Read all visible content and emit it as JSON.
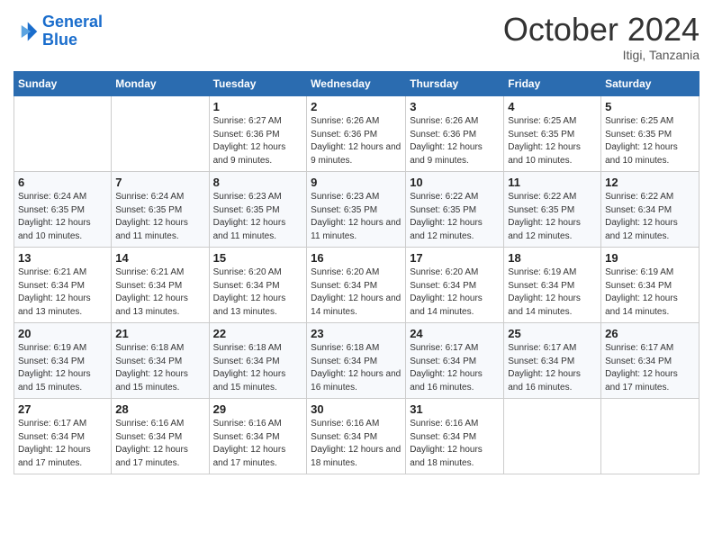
{
  "logo": {
    "line1": "General",
    "line2": "Blue"
  },
  "header": {
    "month": "October 2024",
    "location": "Itigi, Tanzania"
  },
  "weekdays": [
    "Sunday",
    "Monday",
    "Tuesday",
    "Wednesday",
    "Thursday",
    "Friday",
    "Saturday"
  ],
  "weeks": [
    [
      {
        "day": "",
        "info": ""
      },
      {
        "day": "",
        "info": ""
      },
      {
        "day": "1",
        "info": "Sunrise: 6:27 AM\nSunset: 6:36 PM\nDaylight: 12 hours and 9 minutes."
      },
      {
        "day": "2",
        "info": "Sunrise: 6:26 AM\nSunset: 6:36 PM\nDaylight: 12 hours and 9 minutes."
      },
      {
        "day": "3",
        "info": "Sunrise: 6:26 AM\nSunset: 6:36 PM\nDaylight: 12 hours and 9 minutes."
      },
      {
        "day": "4",
        "info": "Sunrise: 6:25 AM\nSunset: 6:35 PM\nDaylight: 12 hours and 10 minutes."
      },
      {
        "day": "5",
        "info": "Sunrise: 6:25 AM\nSunset: 6:35 PM\nDaylight: 12 hours and 10 minutes."
      }
    ],
    [
      {
        "day": "6",
        "info": "Sunrise: 6:24 AM\nSunset: 6:35 PM\nDaylight: 12 hours and 10 minutes."
      },
      {
        "day": "7",
        "info": "Sunrise: 6:24 AM\nSunset: 6:35 PM\nDaylight: 12 hours and 11 minutes."
      },
      {
        "day": "8",
        "info": "Sunrise: 6:23 AM\nSunset: 6:35 PM\nDaylight: 12 hours and 11 minutes."
      },
      {
        "day": "9",
        "info": "Sunrise: 6:23 AM\nSunset: 6:35 PM\nDaylight: 12 hours and 11 minutes."
      },
      {
        "day": "10",
        "info": "Sunrise: 6:22 AM\nSunset: 6:35 PM\nDaylight: 12 hours and 12 minutes."
      },
      {
        "day": "11",
        "info": "Sunrise: 6:22 AM\nSunset: 6:35 PM\nDaylight: 12 hours and 12 minutes."
      },
      {
        "day": "12",
        "info": "Sunrise: 6:22 AM\nSunset: 6:34 PM\nDaylight: 12 hours and 12 minutes."
      }
    ],
    [
      {
        "day": "13",
        "info": "Sunrise: 6:21 AM\nSunset: 6:34 PM\nDaylight: 12 hours and 13 minutes."
      },
      {
        "day": "14",
        "info": "Sunrise: 6:21 AM\nSunset: 6:34 PM\nDaylight: 12 hours and 13 minutes."
      },
      {
        "day": "15",
        "info": "Sunrise: 6:20 AM\nSunset: 6:34 PM\nDaylight: 12 hours and 13 minutes."
      },
      {
        "day": "16",
        "info": "Sunrise: 6:20 AM\nSunset: 6:34 PM\nDaylight: 12 hours and 14 minutes."
      },
      {
        "day": "17",
        "info": "Sunrise: 6:20 AM\nSunset: 6:34 PM\nDaylight: 12 hours and 14 minutes."
      },
      {
        "day": "18",
        "info": "Sunrise: 6:19 AM\nSunset: 6:34 PM\nDaylight: 12 hours and 14 minutes."
      },
      {
        "day": "19",
        "info": "Sunrise: 6:19 AM\nSunset: 6:34 PM\nDaylight: 12 hours and 14 minutes."
      }
    ],
    [
      {
        "day": "20",
        "info": "Sunrise: 6:19 AM\nSunset: 6:34 PM\nDaylight: 12 hours and 15 minutes."
      },
      {
        "day": "21",
        "info": "Sunrise: 6:18 AM\nSunset: 6:34 PM\nDaylight: 12 hours and 15 minutes."
      },
      {
        "day": "22",
        "info": "Sunrise: 6:18 AM\nSunset: 6:34 PM\nDaylight: 12 hours and 15 minutes."
      },
      {
        "day": "23",
        "info": "Sunrise: 6:18 AM\nSunset: 6:34 PM\nDaylight: 12 hours and 16 minutes."
      },
      {
        "day": "24",
        "info": "Sunrise: 6:17 AM\nSunset: 6:34 PM\nDaylight: 12 hours and 16 minutes."
      },
      {
        "day": "25",
        "info": "Sunrise: 6:17 AM\nSunset: 6:34 PM\nDaylight: 12 hours and 16 minutes."
      },
      {
        "day": "26",
        "info": "Sunrise: 6:17 AM\nSunset: 6:34 PM\nDaylight: 12 hours and 17 minutes."
      }
    ],
    [
      {
        "day": "27",
        "info": "Sunrise: 6:17 AM\nSunset: 6:34 PM\nDaylight: 12 hours and 17 minutes."
      },
      {
        "day": "28",
        "info": "Sunrise: 6:16 AM\nSunset: 6:34 PM\nDaylight: 12 hours and 17 minutes."
      },
      {
        "day": "29",
        "info": "Sunrise: 6:16 AM\nSunset: 6:34 PM\nDaylight: 12 hours and 17 minutes."
      },
      {
        "day": "30",
        "info": "Sunrise: 6:16 AM\nSunset: 6:34 PM\nDaylight: 12 hours and 18 minutes."
      },
      {
        "day": "31",
        "info": "Sunrise: 6:16 AM\nSunset: 6:34 PM\nDaylight: 12 hours and 18 minutes."
      },
      {
        "day": "",
        "info": ""
      },
      {
        "day": "",
        "info": ""
      }
    ]
  ]
}
